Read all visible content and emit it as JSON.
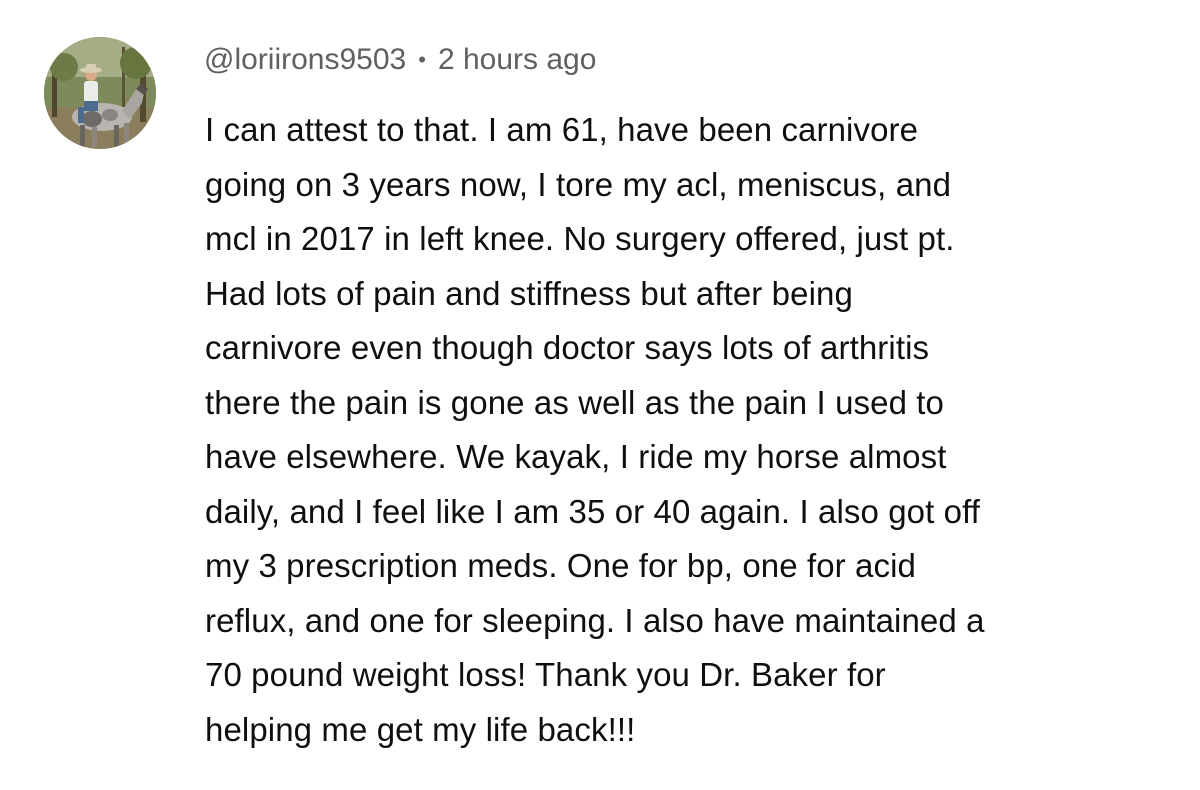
{
  "comment": {
    "author": "@loriirons9503",
    "separator": "•",
    "timestamp": "2 hours ago",
    "avatar_icon": "profile-photo-rider-on-horse",
    "lines": [
      "I can attest to that. I am 61, have been carnivore",
      "going on 3 years now, I tore my acl, meniscus, and",
      "mcl in 2017 in left knee. No surgery offered, just pt.",
      "Had lots of pain and stiffness but after being",
      "carnivore even though doctor says lots of arthritis",
      "there the pain is gone as well as the pain I used to",
      "have elsewhere. We kayak, I ride my horse almost",
      "daily, and I feel like I am 35 or 40 again. I also got off",
      "my 3 prescription meds. One for bp, one for acid",
      "reflux, and one for sleeping. I also have maintained a",
      "70 pound weight loss! Thank you Dr. Baker for",
      "helping me get my life back!!!"
    ]
  },
  "colors": {
    "text": "#0f0f0f",
    "meta": "#606060",
    "background": "#ffffff"
  }
}
